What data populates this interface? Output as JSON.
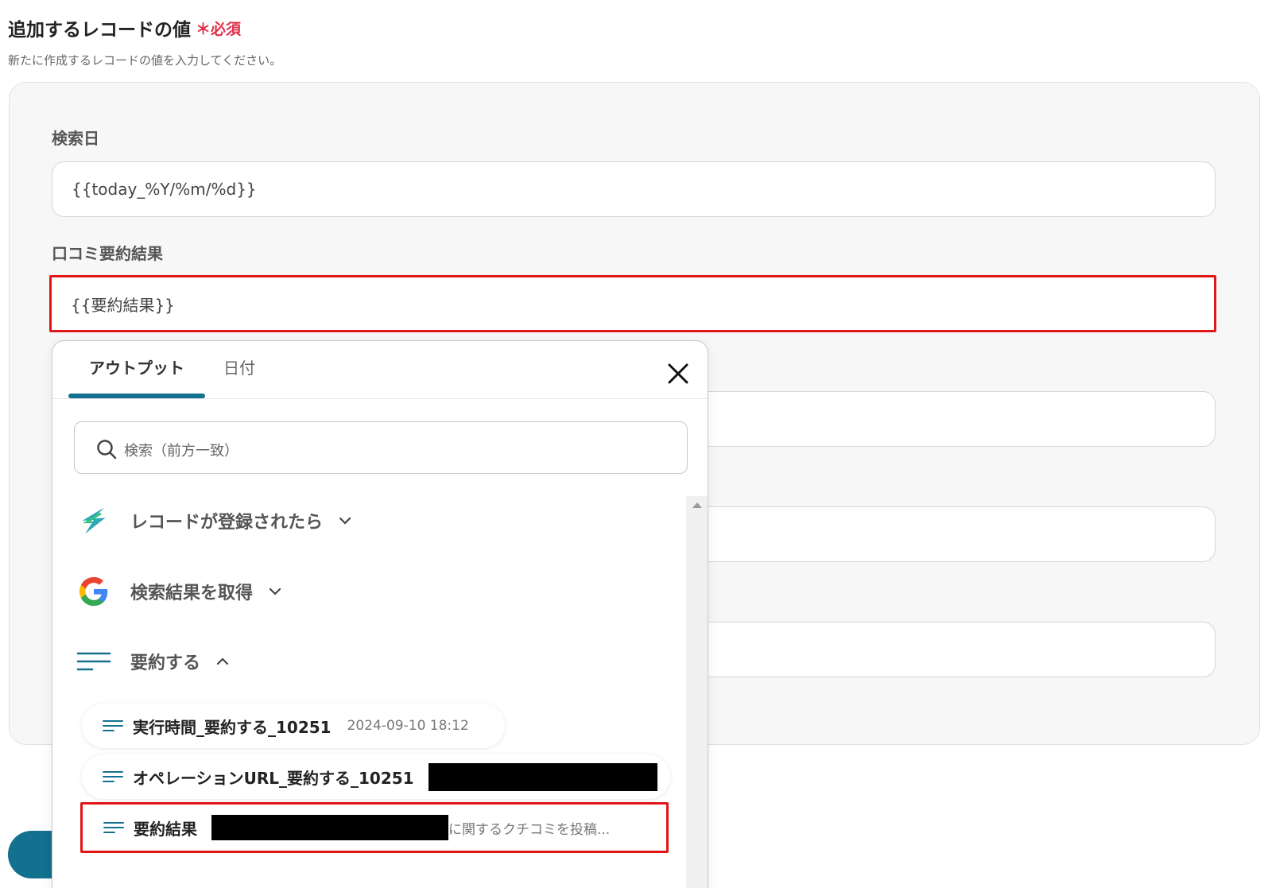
{
  "section": {
    "title": "追加するレコードの値",
    "required": "＊必須",
    "description": "新たに作成するレコードの値を入力してください。"
  },
  "fields": [
    {
      "label": "検索日",
      "value": "{{today_%Y/%m/%d}}"
    },
    {
      "label": "口コミ要約結果",
      "value": "{{要約結果}}"
    }
  ],
  "popup": {
    "tabs": [
      {
        "label": "アウトプット"
      },
      {
        "label": "日付"
      }
    ],
    "search_placeholder": "検索（前方一致）",
    "groups": [
      {
        "label": "レコードが登録されたら",
        "icon": "lightning-logo-icon",
        "expanded": false
      },
      {
        "label": "検索結果を取得",
        "icon": "google-logo-icon",
        "expanded": false
      },
      {
        "label": "要約する",
        "icon": "summary-lines-icon",
        "expanded": true
      }
    ],
    "items": [
      {
        "label": "実行時間_要約する_10251",
        "value": "2024-09-10 18:12"
      },
      {
        "label": "オペレーションURL_要約する_10251",
        "value": ""
      },
      {
        "label": "要約結果",
        "value": "に関するクチコミを投稿..."
      }
    ]
  },
  "colors": {
    "accent": "#14708f",
    "highlight": "#e01616",
    "required": "#e0304a"
  }
}
